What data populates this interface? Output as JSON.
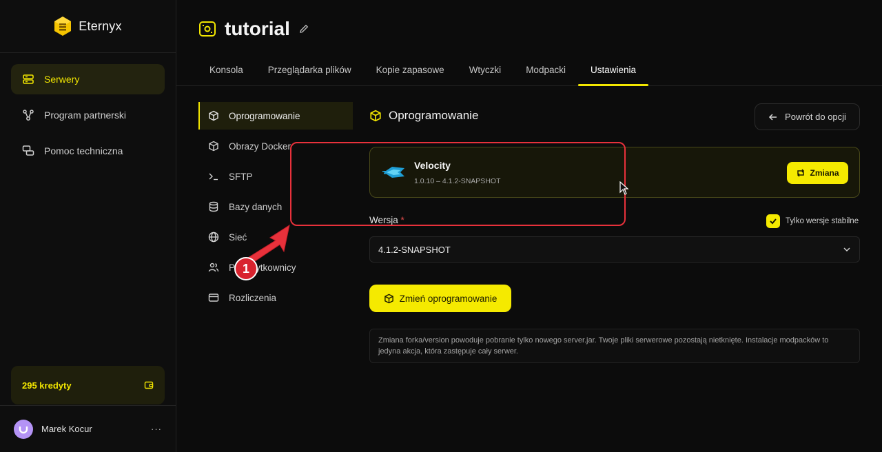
{
  "sidebar": {
    "brand": "Eternyx",
    "items": [
      {
        "label": "Serwery",
        "icon": "server-icon"
      },
      {
        "label": "Program partnerski",
        "icon": "share-icon"
      },
      {
        "label": "Pomoc techniczna",
        "icon": "chat-icon"
      }
    ],
    "credits": "295 kredyty",
    "user_name": "Marek Kocur"
  },
  "header": {
    "title": "tutorial",
    "tabs": [
      "Konsola",
      "Przeglądarka plików",
      "Kopie zapasowe",
      "Wtyczki",
      "Modpacki",
      "Ustawienia"
    ],
    "active_tab": "Ustawienia"
  },
  "settings_menu": [
    {
      "label": "Oprogramowanie",
      "icon": "box-icon"
    },
    {
      "label": "Obrazy Docker",
      "icon": "box-icon"
    },
    {
      "label": "SFTP",
      "icon": "terminal-icon"
    },
    {
      "label": "Bazy danych",
      "icon": "database-icon"
    },
    {
      "label": "Sieć",
      "icon": "globe-icon"
    },
    {
      "label": "Podużytkownicy",
      "visible_label": "Po      ytkownicy",
      "icon": "users-icon"
    },
    {
      "label": "Rozliczenia",
      "icon": "card-icon"
    }
  ],
  "content": {
    "title": "Oprogramowanie",
    "back_label": "Powrót do opcji",
    "software_name": "Velocity",
    "software_version": "1.0.10 – 4.1.2-SNAPSHOT",
    "change_label": "Zmiana",
    "version_label": "Wersja",
    "required_mark": "*",
    "stable_only_label": "Tylko wersje stabilne",
    "stable_only_checked": true,
    "selected_version": "4.1.2-SNAPSHOT",
    "submit_label": "Zmień oprogramowanie",
    "note": "Zmiana forka/version powoduje pobranie tylko nowego server.jar. Twoje pliki serwerowe pozostają nietknięte. Instalacje modpacków to jedyna akcja, która zastępuje cały serwer."
  },
  "annotation": {
    "badge": "1"
  },
  "colors": {
    "accent": "#f5ea00",
    "annotation": "#e8313b"
  }
}
